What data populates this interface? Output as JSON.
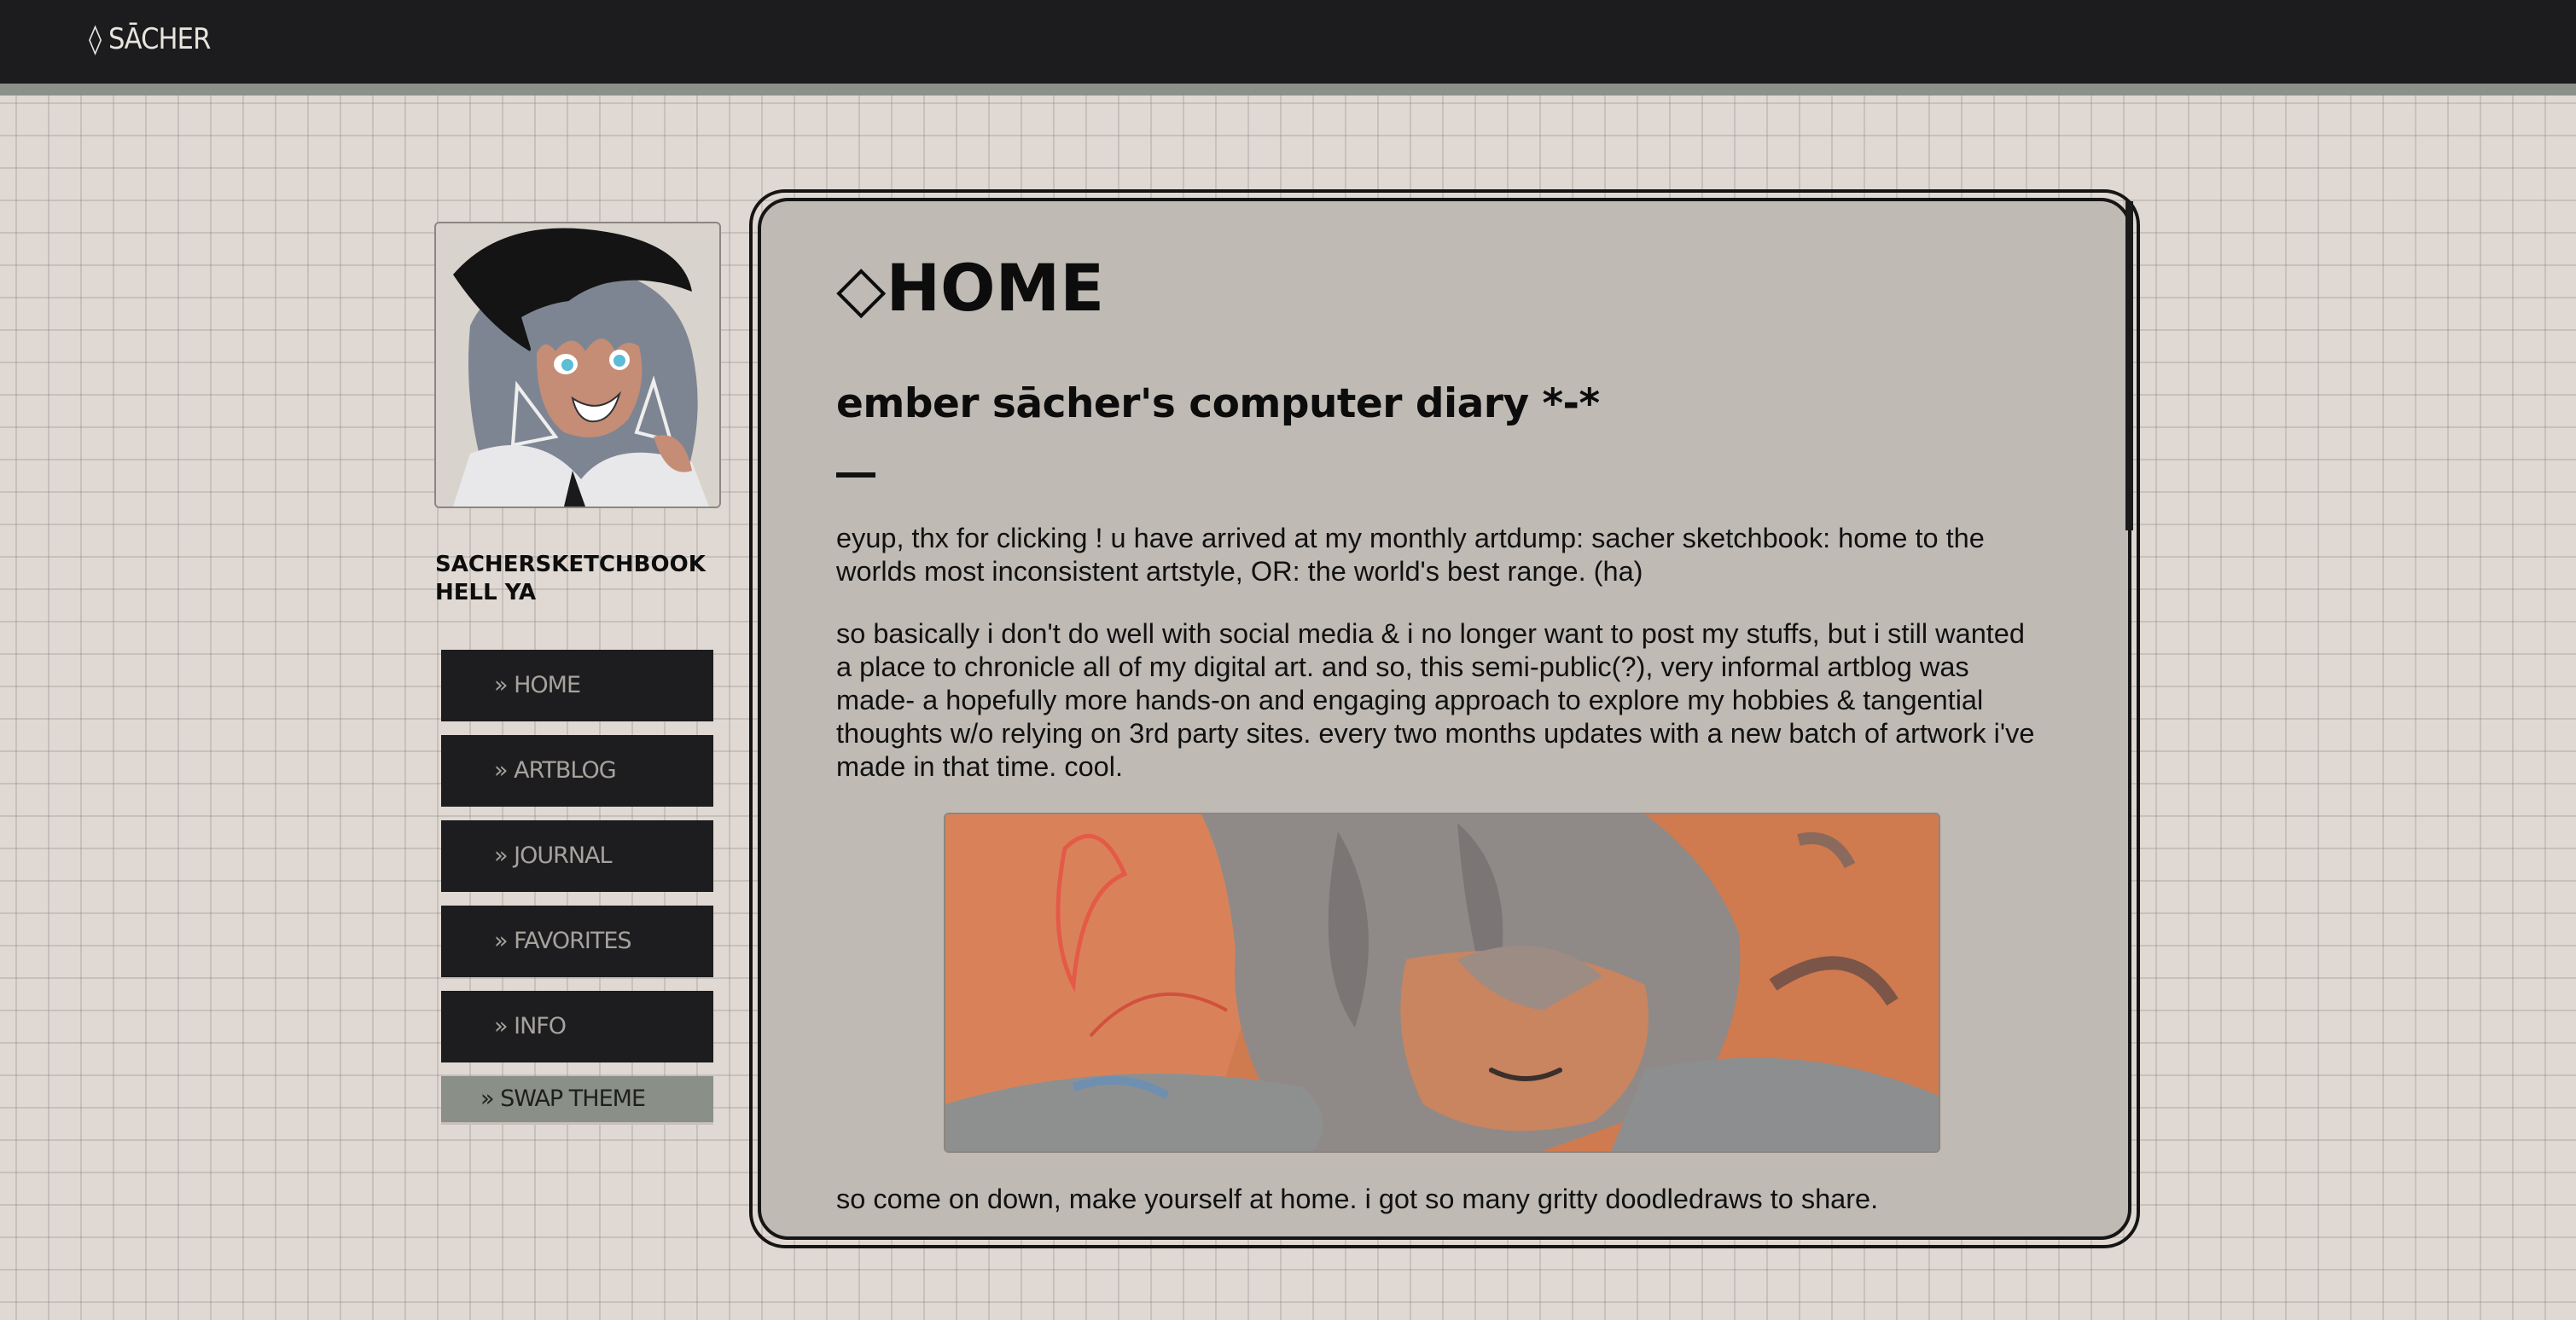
{
  "topbar": {
    "brand": "◊ SĀCHER"
  },
  "sidebar": {
    "site_title": "SACHERSKETCHBOOK HELL YA",
    "nav": [
      {
        "label": "» HOME"
      },
      {
        "label": "» ARTBLOG"
      },
      {
        "label": "» JOURNAL"
      },
      {
        "label": "» FAVORITES"
      },
      {
        "label": "» INFO"
      }
    ],
    "swap_theme": "» SWAP THEME"
  },
  "main": {
    "heading_glyph": "◇",
    "heading": "HOME",
    "subtitle": "ember sācher's computer diary *-*",
    "paragraphs": [
      "eyup, thx for clicking ! u have arrived at my monthly artdump: sacher sketchbook: home to the worlds most inconsistent artstyle, OR: the world's best range. (ha)",
      "so basically i don't do well with social media & i no longer want to post my stuffs, but i still wanted a place to chronicle all of my digital art. and so, this semi-public(?), very informal artblog was made- a hopefully more hands-on and engaging approach to explore my hobbies & tangential thoughts w/o relying on 3rd party sites. every two months updates with a new batch of artwork i've made in that time. cool.",
      "so come on down, make yourself at home. i got so many gritty doodledraws to share."
    ]
  },
  "colors": {
    "topbar": "#1c1b1d",
    "topbar_border": "#8b9189",
    "page_bg": "#e0d8d2",
    "panel_bg": "#bfbab4",
    "nav_bg": "#1d1c1e",
    "nav_text": "#a6a29d",
    "swap_bg": "#8a8f87",
    "art_orange": "#d0764a"
  }
}
